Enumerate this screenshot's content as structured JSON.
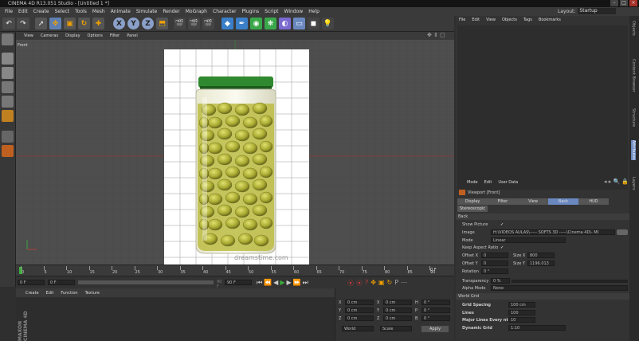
{
  "window": {
    "title": "CINEMA 4D R13.051 Studio - [Untitled 1 *]",
    "layout_label": "Layout:",
    "layout_value": "Startup"
  },
  "menu": [
    "File",
    "Edit",
    "Create",
    "Select",
    "Tools",
    "Mesh",
    "Animate",
    "Simulate",
    "Render",
    "MoGraph",
    "Character",
    "Plugins",
    "Script",
    "Window",
    "Help"
  ],
  "toolbar": {
    "x_label": "X",
    "y_label": "Y",
    "z_label": "Z"
  },
  "viewport": {
    "menu": [
      "View",
      "Cameras",
      "Display",
      "Options",
      "Filter",
      "Panel"
    ],
    "label": "Front",
    "watermark": "dreamstime.com"
  },
  "timeline": {
    "ticks": [
      "0",
      "5",
      "10",
      "15",
      "20",
      "25",
      "30",
      "35",
      "40",
      "45",
      "50",
      "55",
      "60",
      "65",
      "70",
      "75",
      "80",
      "85",
      "90"
    ],
    "end_label": "0 F"
  },
  "transport": {
    "current_frame": "0 F",
    "start_frame": "0 F",
    "end_frame": "90 F",
    "max_frame": "90 F"
  },
  "materials": {
    "menu": [
      "Create",
      "Edit",
      "Function",
      "Texture"
    ]
  },
  "coordinates": {
    "rows": [
      {
        "a": "X",
        "av": "0 cm",
        "b": "X",
        "bv": "0 cm",
        "c": "H",
        "cv": "0 °"
      },
      {
        "a": "Y",
        "av": "0 cm",
        "b": "Y",
        "bv": "0 cm",
        "c": "P",
        "cv": "0 °"
      },
      {
        "a": "Z",
        "av": "0 cm",
        "b": "Z",
        "bv": "0 cm",
        "c": "B",
        "cv": "0 °"
      }
    ],
    "world": "World",
    "scale": "Scale",
    "apply": "Apply"
  },
  "object_manager": {
    "menu": [
      "File",
      "Edit",
      "View",
      "Objects",
      "Tags",
      "Bookmarks"
    ]
  },
  "attributes": {
    "menu": [
      "Mode",
      "Edit",
      "User Data"
    ],
    "title": "Viewport [Front]",
    "tabs": [
      "Display",
      "Filter",
      "View",
      "Back",
      "HUD"
    ],
    "active_tab": "Back",
    "subtab": "Stereoscopic",
    "section": "Back",
    "show_picture": "Show Picture",
    "check": "✓",
    "image_label": "Image",
    "image_value": "H:\\VIDEOS AULAS\\----- SOFTS 3D -----\\Cinema 4D\\- MI",
    "mode_label": "Mode",
    "mode_value": "Linear",
    "keep_aspect": "Keep Aspect Ratio",
    "offset_x_label": "Offset X",
    "offset_x": "0",
    "size_x_label": "Size X",
    "size_x": "800",
    "offset_y_label": "Offset Y",
    "offset_y": "0",
    "size_y_label": "Size Y",
    "size_y": "1196.013",
    "rotation_label": "Rotation",
    "rotation": "0 °",
    "transparency_label": "Transparency",
    "transparency": "0 %",
    "alpha_label": "Alpha Mode",
    "alpha_value": "None",
    "world_grid": "World Grid",
    "grid_spacing_label": "Grid Spacing",
    "grid_spacing": "100 cm",
    "lines_label": "Lines",
    "lines": "100",
    "major_label": "Major Lines Every nth",
    "major": "10",
    "dynamic_label": "Dynamic Grid",
    "dynamic": "1:10"
  },
  "side_tabs": [
    "Objects",
    "Content Browser",
    "Structure",
    "Attributes",
    "Layers"
  ],
  "brand": "MAXON CINEMA 4D",
  "colors": {
    "accent": "#5f7fb0",
    "jar_lid": "#2f8a2f",
    "olive": "#a8a930"
  }
}
